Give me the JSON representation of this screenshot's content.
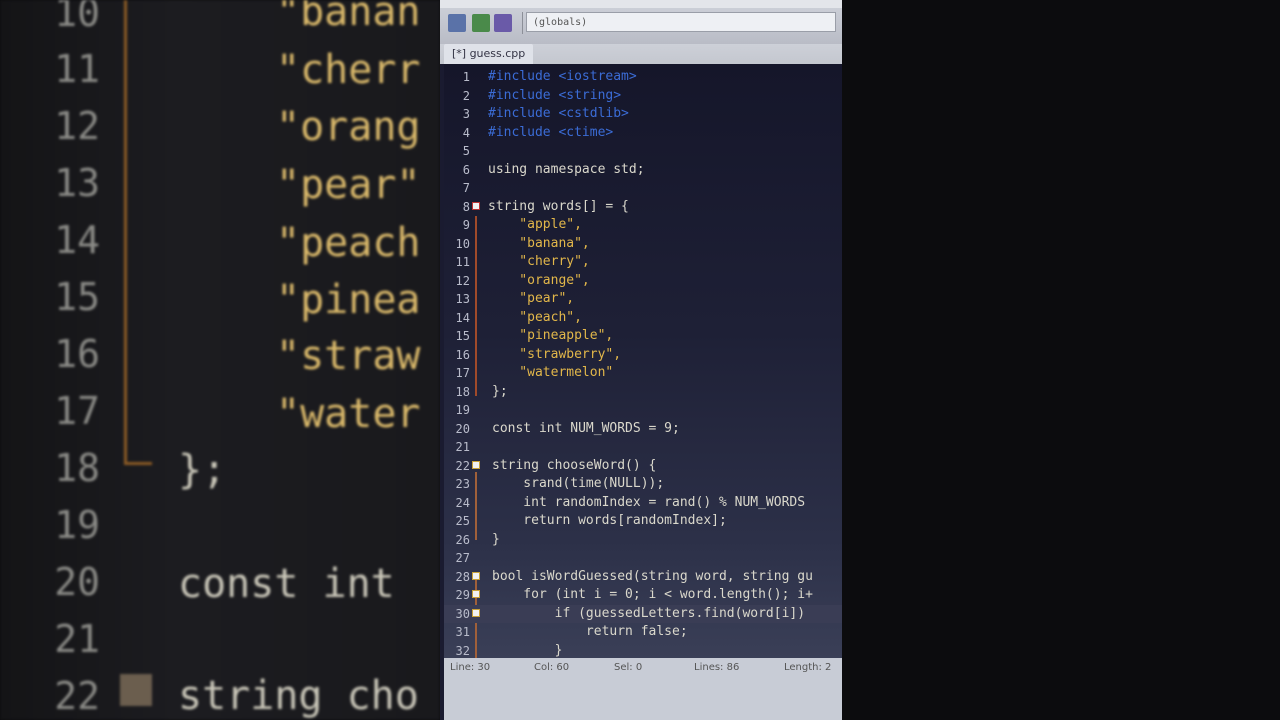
{
  "background": {
    "line_numbers": [
      "10",
      "11",
      "12",
      "13",
      "14",
      "15",
      "16",
      "17",
      "18",
      "19",
      "20",
      "21",
      "22"
    ],
    "code_strings": [
      "\"banan",
      "\"cherr",
      "\"orang",
      "\"pear\"",
      "\"peach",
      "\"pinea",
      "\"straw",
      "\"water"
    ],
    "code_lines": [
      "};",
      "const int",
      "string cho"
    ]
  },
  "toolbar": {
    "scope_value": "(globals)",
    "icons": [
      "class-browser-icon",
      "back-icon",
      "bookmark-icon"
    ]
  },
  "tab": {
    "label": "[*] guess.cpp"
  },
  "editor": {
    "lines": [
      {
        "n": "1",
        "text": "#include <iostream>",
        "type": "pp"
      },
      {
        "n": "2",
        "text": "#include <string>",
        "type": "pp"
      },
      {
        "n": "3",
        "text": "#include <cstdlib>",
        "type": "pp"
      },
      {
        "n": "4",
        "text": "#include <ctime>",
        "type": "pp"
      },
      {
        "n": "5",
        "text": "",
        "type": "plain"
      },
      {
        "n": "6",
        "text": "using namespace std;",
        "type": "plain"
      },
      {
        "n": "7",
        "text": "",
        "type": "plain"
      },
      {
        "n": "8",
        "text": "string words[] = {",
        "type": "plain"
      },
      {
        "n": "9",
        "text": "    \"apple\",",
        "type": "str"
      },
      {
        "n": "10",
        "text": "    \"banana\",",
        "type": "str"
      },
      {
        "n": "11",
        "text": "    \"cherry\",",
        "type": "str"
      },
      {
        "n": "12",
        "text": "    \"orange\",",
        "type": "str"
      },
      {
        "n": "13",
        "text": "    \"pear\",",
        "type": "str"
      },
      {
        "n": "14",
        "text": "    \"peach\",",
        "type": "str"
      },
      {
        "n": "15",
        "text": "    \"pineapple\",",
        "type": "str"
      },
      {
        "n": "16",
        "text": "    \"strawberry\",",
        "type": "str"
      },
      {
        "n": "17",
        "text": "    \"watermelon\"",
        "type": "str"
      },
      {
        "n": "18",
        "text": "};",
        "type": "plain"
      },
      {
        "n": "19",
        "text": "",
        "type": "plain"
      },
      {
        "n": "20",
        "text": "const int NUM_WORDS = 9;",
        "type": "plain"
      },
      {
        "n": "21",
        "text": "",
        "type": "plain"
      },
      {
        "n": "22",
        "text": "string chooseWord() {",
        "type": "plain"
      },
      {
        "n": "23",
        "text": "    srand(time(NULL));",
        "type": "plain"
      },
      {
        "n": "24",
        "text": "    int randomIndex = rand() % NUM_WORDS",
        "type": "plain"
      },
      {
        "n": "25",
        "text": "    return words[randomIndex];",
        "type": "plain"
      },
      {
        "n": "26",
        "text": "}",
        "type": "plain"
      },
      {
        "n": "27",
        "text": "",
        "type": "plain"
      },
      {
        "n": "28",
        "text": "bool isWordGuessed(string word, string gu",
        "type": "plain"
      },
      {
        "n": "29",
        "text": "    for (int i = 0; i < word.length(); i+",
        "type": "plain"
      },
      {
        "n": "30",
        "text": "        if (guessedLetters.find(word[i])",
        "type": "plain"
      },
      {
        "n": "31",
        "text": "            return false;",
        "type": "plain"
      },
      {
        "n": "32",
        "text": "        }",
        "type": "plain"
      }
    ]
  },
  "status": {
    "line": "Line: 30",
    "col": "Col: 60",
    "sel": "Sel: 0",
    "lines": "Lines: 86",
    "length": "Length: 2"
  },
  "colors": {
    "preprocessor": "#3b6cd6",
    "string": "#e2b74a",
    "text": "#dad8cc",
    "editor_bg": "#1e2036"
  }
}
